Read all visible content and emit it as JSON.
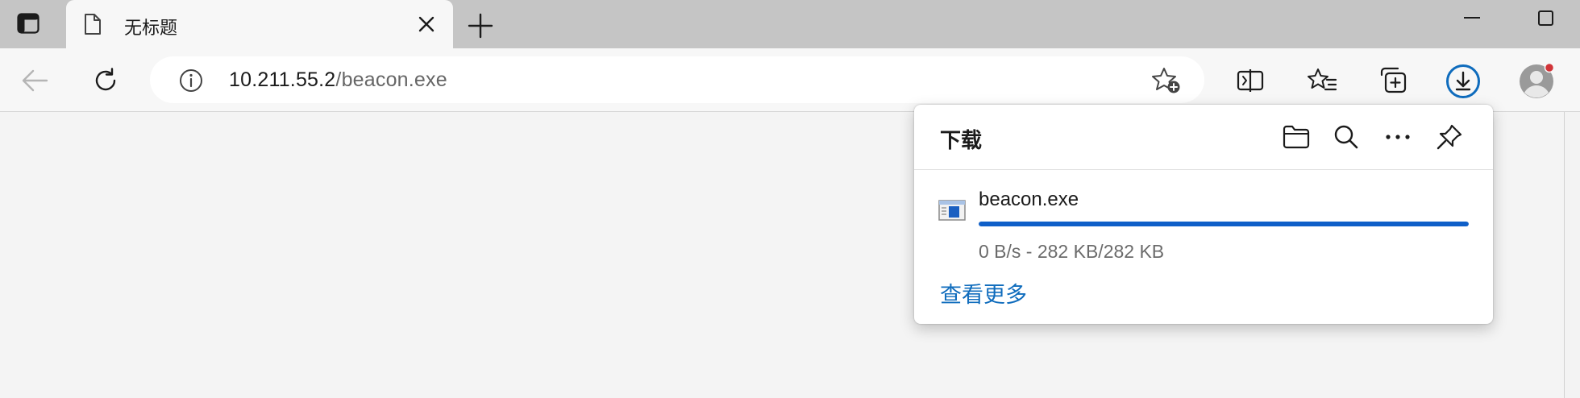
{
  "tab": {
    "title": "无标题",
    "icons": {
      "tab_actions": "tab-actions-icon",
      "page": "page-icon",
      "close": "close-icon",
      "new_tab": "plus-icon"
    }
  },
  "window": {
    "icons": {
      "minimize": "minimize-icon",
      "maximize": "maximize-icon"
    }
  },
  "toolbar": {
    "url_host": "10.211.55.2",
    "url_path": "/beacon.exe",
    "icons": {
      "back": "back-arrow-icon",
      "refresh": "refresh-icon",
      "site_info": "info-icon",
      "add_favorite": "star-add-icon",
      "split_screen": "split-screen-icon",
      "favorites": "favorites-icon",
      "collections": "collections-icon",
      "downloads": "download-icon",
      "profile": "profile-avatar"
    },
    "colors": {
      "accent": "#0f6cbd",
      "notification_dot": "#d13438"
    }
  },
  "downloads": {
    "title": "下载",
    "icons": {
      "open_folder": "folder-icon",
      "search": "search-icon",
      "more": "more-options-icon",
      "pin": "pin-icon"
    },
    "items": [
      {
        "file_name": "beacon.exe",
        "progress": 1.0,
        "status": "0 B/s - 282 KB/282 KB",
        "icon": "exe-file-icon"
      }
    ],
    "see_more": "查看更多",
    "colors": {
      "progress": "#0f5fc8",
      "link": "#0f6cbd"
    }
  }
}
